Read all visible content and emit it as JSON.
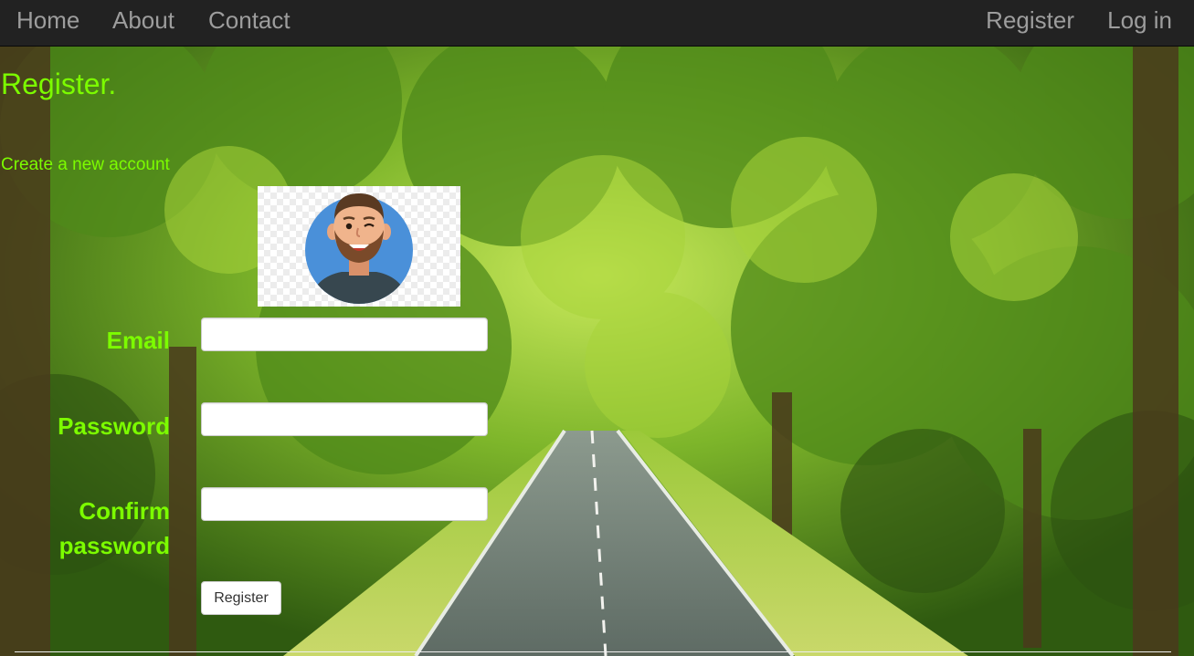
{
  "nav": {
    "home": "Home",
    "about": "About",
    "contact": "Contact",
    "register": "Register",
    "login": "Log in"
  },
  "page": {
    "title": "Register.",
    "subtitle": "Create a new account"
  },
  "form": {
    "email_label": "Email",
    "email_value": "",
    "password_label": "Password",
    "password_value": "",
    "confirm_label": "Confirm password",
    "confirm_value": "",
    "submit_label": "Register"
  },
  "colors": {
    "accent_green": "#7cfc00",
    "navbar_bg": "#222222",
    "nav_text": "#9d9d9d",
    "avatar_circle": "#4a90d9"
  },
  "icons": {
    "avatar": "cartoon-man-avatar",
    "background": "tree-lined-road-photo"
  }
}
